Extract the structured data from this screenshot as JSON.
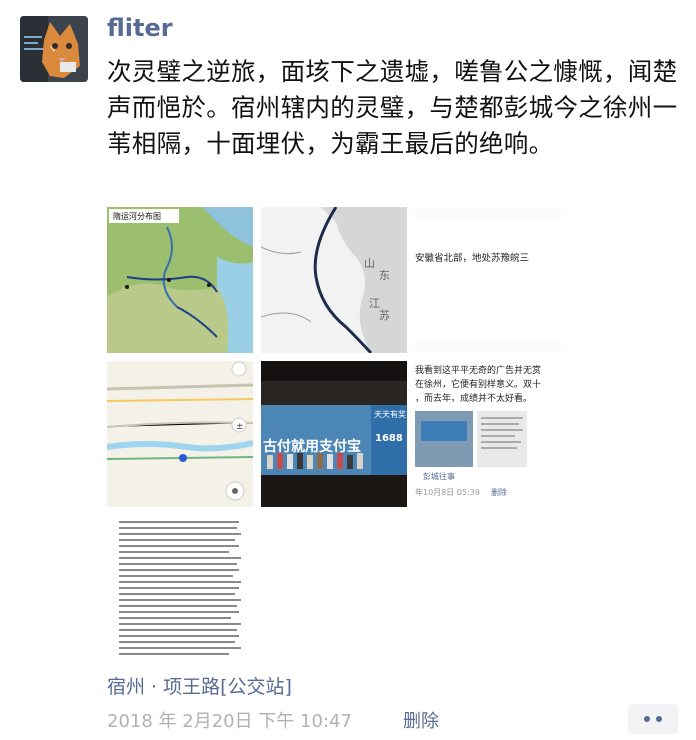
{
  "post": {
    "author": "fliter",
    "text": "次灵璧之逆旅，面垓下之遗墟，嗟鲁公之慷慨，闻楚声而悒於。宿州辖内的灵璧，与楚都彭城今之徐州一苇相隔，十面埋伏，为霸王最后的绝响。",
    "location": "宿州 · 项王路[公交站]",
    "timestamp": "2018 年 2月20日 下午 10:47",
    "delete_label": "删除"
  },
  "images": {
    "map1_title": "隋运河分布图",
    "map2_labels": [
      "山",
      "东",
      "江",
      "苏"
    ],
    "article1_line": "安徽省北部，地处苏豫皖三",
    "article2_lines": [
      "我看到这平平无奇的广告并无赏",
      "在徐州，它便有别样意义。双十",
      "，而去年，成绩并不太好看。"
    ],
    "article2_source": "彭城往事",
    "article2_meta": "年10月8日 05:39",
    "article2_delete": "删除",
    "banner_text": "古付就用支付宝",
    "banner_top": "天天有奖",
    "banner_number": "1688"
  }
}
